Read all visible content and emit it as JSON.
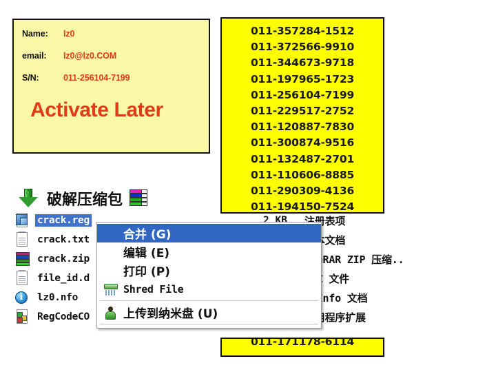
{
  "keygen": {
    "name_label": "Name:",
    "name_value": "lz0",
    "email_label": "email:",
    "email_value": "lz0@lz0.COM",
    "sn_label": "S/N:",
    "sn_value": "011-256104-7199",
    "activate_later": "Activate Later",
    "panel_bg": "#fbf8a8",
    "accent_color": "#e03a16"
  },
  "serial_list": {
    "bg": "#ffff00",
    "items": [
      "011-357284-1512",
      "011-372566-9910",
      "011-344673-9718",
      "011-197965-1723",
      "011-256104-7199",
      "011-229517-2752",
      "011-120887-7830",
      "011-300874-9516",
      "011-132487-2701",
      "011-110606-8885",
      "011-290309-4136",
      "011-194150-7524"
    ],
    "strip_item": "011-171178-6114"
  },
  "explorer": {
    "title": "破解压缩包",
    "arrow_icon": "arrow-down-icon",
    "archive_icon": "books-icon",
    "files": [
      {
        "name": "crack.reg",
        "icon": "registry-file-icon",
        "size": "2 KB",
        "type": "注册表项",
        "selected": true
      },
      {
        "name": "crack.txt",
        "icon": "text-file-icon",
        "size": "",
        "type": "文本文档",
        "selected": false
      },
      {
        "name": "crack.zip",
        "icon": "zip-file-icon",
        "size": "",
        "type": "WinRAR ZIP 压缩..",
        "selected": false
      },
      {
        "name": "file_id.d",
        "icon": "text-file-icon",
        "size": "",
        "type": "DIZ 文件",
        "selected": false
      },
      {
        "name": "lz0.nfo",
        "icon": "nfo-file-icon",
        "size": "",
        "type": "NSInfo 文档",
        "selected": false
      },
      {
        "name": "RegCodeCO",
        "icon": "dll-file-icon",
        "size": "",
        "type": "应用程序扩展",
        "selected": false
      }
    ]
  },
  "context_menu": {
    "highlight_color": "#3166c3",
    "items": [
      {
        "label": "合并 (G)",
        "icon": "",
        "highlight": true,
        "cjk": true
      },
      {
        "label": "编辑 (E)",
        "icon": "",
        "highlight": false,
        "cjk": true
      },
      {
        "label": "打印 (P)",
        "icon": "",
        "highlight": false,
        "cjk": true
      },
      {
        "label": "Shred File",
        "icon": "shredder-icon",
        "highlight": false,
        "cjk": false
      },
      {
        "label": "上传到纳米盘 (U)",
        "icon": "person-icon",
        "highlight": false,
        "cjk": true
      }
    ]
  }
}
